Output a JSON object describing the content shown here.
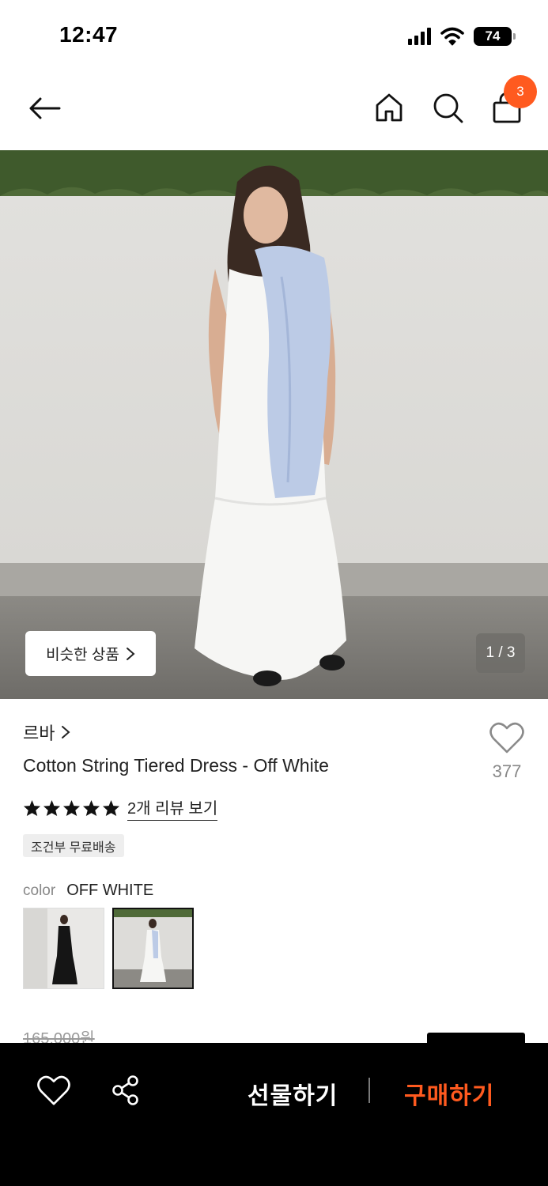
{
  "status_bar": {
    "time": "12:47",
    "battery": "74",
    "icons": [
      "signal-icon",
      "wifi-icon",
      "battery-icon"
    ]
  },
  "nav": {
    "icons": [
      "back-arrow-icon",
      "home-icon",
      "search-icon",
      "shopping-bag-icon"
    ],
    "cart_count": "3",
    "badge_color": "#ff5a1f"
  },
  "hero": {
    "similar_label": "비슷한 상품",
    "page_indicator": "1 / 3"
  },
  "product": {
    "brand": "르바",
    "title": "Cotton String Tiered Dress - Off White",
    "wish_count": "377",
    "rating_stars": 5,
    "review_link": "2개 리뷰 보기",
    "shipping_tag": "조건부 무료배송",
    "color_label": "color",
    "color_value": "OFF WHITE",
    "original_price": "165,000원"
  },
  "bottom_bar": {
    "gift_label": "선물하기",
    "buy_label": "구매하기",
    "accent_color": "#ff5a1f"
  }
}
